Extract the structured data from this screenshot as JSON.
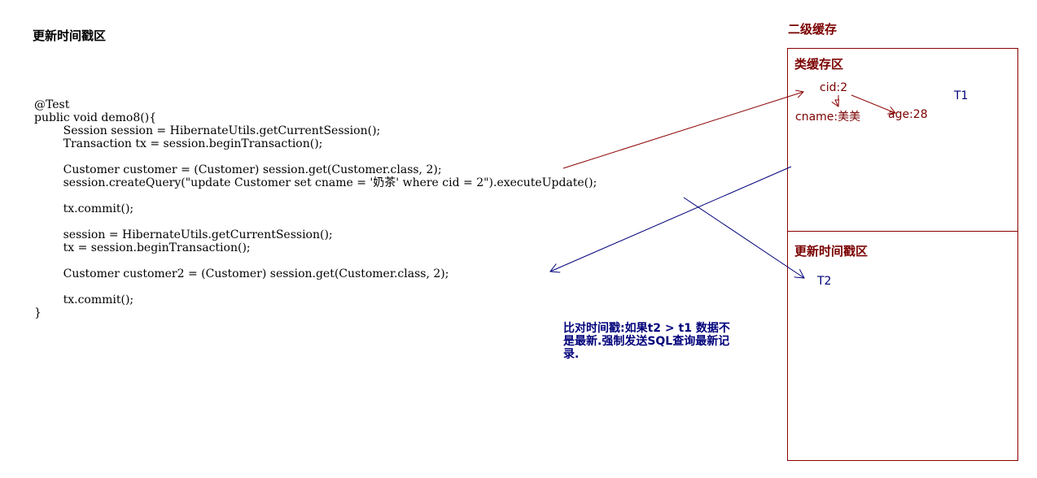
{
  "page_title": "更新时间戳区",
  "code_lines": [
    "@Test",
    "public void demo8(){",
    "        Session session = HibernateUtils.getCurrentSession();",
    "        Transaction tx = session.beginTransaction();",
    "",
    "        Customer customer = (Customer) session.get(Customer.class, 2);",
    "        session.createQuery(\"update Customer set cname = '奶茶' where cid = 2\").executeUpdate();",
    "",
    "        tx.commit();",
    "",
    "        session = HibernateUtils.getCurrentSession();",
    "        tx = session.beginTransaction();",
    "",
    "        Customer customer2 = (Customer) session.get(Customer.class, 2);",
    "",
    "        tx.commit();",
    "}"
  ],
  "cache": {
    "title": "二级缓存",
    "class_region": {
      "title": "类缓存区",
      "cid": "cid:2",
      "cname": "cname:美美",
      "age": "age:28",
      "timestamp": "T1"
    },
    "timestamp_region": {
      "title": "更新时间戳区",
      "timestamp": "T2"
    }
  },
  "note": "比对时间戳:如果t2 > t1 数据不\n是最新.强制发送SQL查询最新记\n录.",
  "colors": {
    "dark_red": "#8b0000",
    "navy": "#00007a",
    "black": "#000000"
  }
}
